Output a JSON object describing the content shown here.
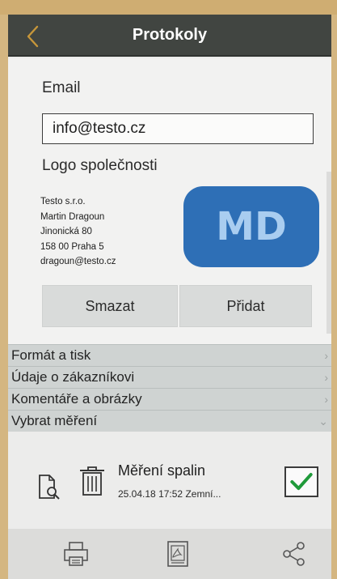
{
  "header": {
    "title": "Protokoly",
    "back_icon": "chevron-left-icon",
    "accent_color": "#c7973a"
  },
  "form": {
    "email_label": "Email",
    "email_value": "info@testo.cz",
    "logo_label": "Logo společnosti"
  },
  "company": {
    "lines": [
      "Testo s.r.o.",
      "Martin Dragoun",
      "Jinonická 80",
      "158 00 Praha 5",
      "dragoun@testo.cz"
    ],
    "logo_text": "MD",
    "logo_color": "#2e6fb6"
  },
  "buttons": {
    "delete_label": "Smazat",
    "add_label": "Přidat"
  },
  "sections": [
    {
      "label": "Formát a tisk",
      "state": "collapsed"
    },
    {
      "label": "Údaje o zákazníkovi",
      "state": "collapsed"
    },
    {
      "label": "Komentáře a obrázky",
      "state": "collapsed"
    },
    {
      "label": "Vybrat měření",
      "state": "expanded"
    }
  ],
  "measurement": {
    "title": "Měření spalin",
    "date": "25.04.18",
    "time": "17:52",
    "location": "Zemní...",
    "checked": true,
    "check_color": "#1f9a3a"
  },
  "bottom_bar": {
    "icons": [
      "printer-icon",
      "pdf-document-icon",
      "share-icon"
    ]
  }
}
